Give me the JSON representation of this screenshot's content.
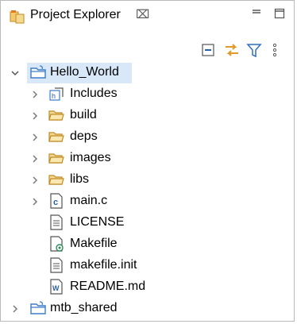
{
  "panel": {
    "title": "Project Explorer",
    "close_glyph": "⌧"
  },
  "tree": {
    "project": {
      "label": "Hello_World",
      "expanded": true,
      "selected": true
    },
    "children": [
      {
        "label": "Includes",
        "icon": "includes-icon",
        "expandable": true
      },
      {
        "label": "build",
        "icon": "folder-icon",
        "expandable": true
      },
      {
        "label": "deps",
        "icon": "folder-icon",
        "expandable": true
      },
      {
        "label": "images",
        "icon": "folder-icon",
        "expandable": true
      },
      {
        "label": "libs",
        "icon": "folder-icon",
        "expandable": true
      },
      {
        "label": "main.c",
        "icon": "c-file-icon",
        "expandable": true
      },
      {
        "label": "LICENSE",
        "icon": "text-file-icon",
        "expandable": false
      },
      {
        "label": "Makefile",
        "icon": "makefile-icon",
        "expandable": false
      },
      {
        "label": "makefile.init",
        "icon": "text-file-icon",
        "expandable": false
      },
      {
        "label": "README.md",
        "icon": "markdown-file-icon",
        "expandable": false
      }
    ],
    "second_project": {
      "label": "mtb_shared",
      "expanded": false
    }
  },
  "colors": {
    "selection": "#d8e8f9",
    "folder": "#e8b64a",
    "project_folder": "#3d7cc9",
    "accent_orange": "#e6781e",
    "chevron": "#7a7a7a"
  }
}
